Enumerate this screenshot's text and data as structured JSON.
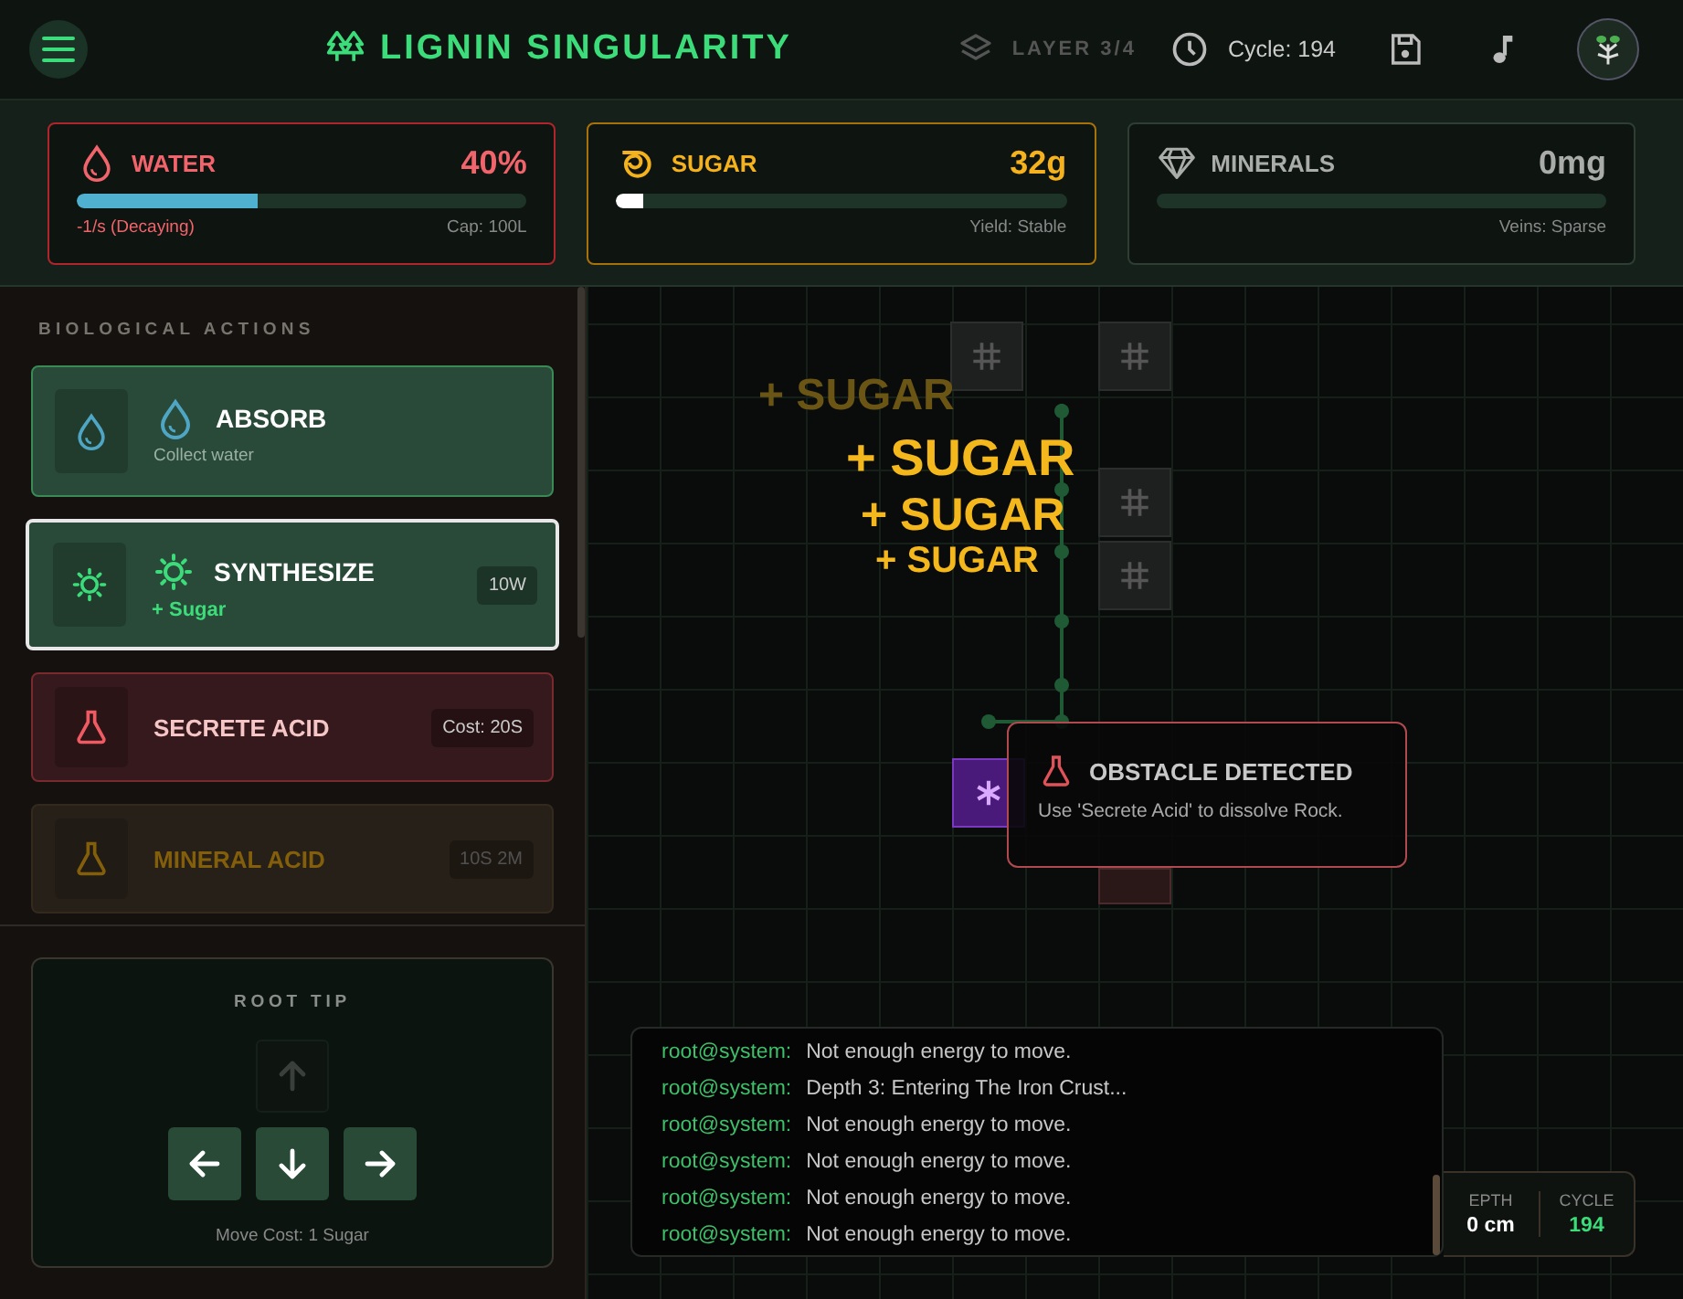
{
  "header": {
    "title": "LIGNIN SINGULARITY",
    "layer": "LAYER 3/4",
    "cycle": "Cycle: 194"
  },
  "resources": [
    {
      "kind": "water",
      "name": "WATER",
      "value": "40%",
      "level": 0.4,
      "note_left": "-1/s (Decaying)",
      "note_right": "Cap: 100L"
    },
    {
      "kind": "sugar",
      "name": "SUGAR",
      "value": "32g",
      "level": 0.06,
      "note_right": "Yield: Stable"
    },
    {
      "kind": "minerals",
      "name": "MINERALS",
      "value": "0mg",
      "note_right": "Veins: Sparse"
    }
  ],
  "sidebar": {
    "heading": "BIOLOGICAL ACTIONS",
    "actions": [
      {
        "kind": "water",
        "title": "ABSORB",
        "subtitle": "Collect water",
        "selected": false,
        "disabled": false
      },
      {
        "kind": "sun",
        "title": "SYNTHESIZE",
        "subtitle": "+ Sugar",
        "badge": "10W",
        "selected": true,
        "disabled": false
      },
      {
        "kind": "acid",
        "title": "SECRETE ACID",
        "badge": "Cost: 20S",
        "selected": false,
        "disabled": false
      },
      {
        "kind": "mineral",
        "title": "MINERAL ACID",
        "badge": "10S 2M",
        "selected": false,
        "disabled": true
      }
    ]
  },
  "root_tip": {
    "title": "ROOT TIP",
    "buttons": [
      {
        "kind": "up",
        "disabled": true
      },
      {
        "kind": "left",
        "disabled": false
      },
      {
        "kind": "down",
        "disabled": false
      },
      {
        "kind": "right",
        "disabled": false
      }
    ],
    "move_cost": "Move Cost: 1 Sugar"
  },
  "canvas": {
    "floaters": [
      {
        "text": "+ SUGAR",
        "faded": true
      },
      {
        "text": "+ SUGAR",
        "faded": false
      },
      {
        "text": "+ SUGAR",
        "faded": false
      },
      {
        "text": "+ SUGAR",
        "faded": false
      }
    ],
    "tooltip": {
      "title": "OBSTACLE DETECTED",
      "text": "Use 'Secrete Acid' to dissolve Rock."
    }
  },
  "log": [
    {
      "user": "root@system:",
      "message": "Not enough energy to move."
    },
    {
      "user": "root@system:",
      "message": "Depth 3: Entering The Iron Crust..."
    },
    {
      "user": "root@system:",
      "message": "Not enough energy to move."
    },
    {
      "user": "root@system:",
      "message": "Not enough energy to move."
    },
    {
      "user": "root@system:",
      "message": "Not enough energy to move."
    },
    {
      "user": "root@system:",
      "message": "Not enough energy to move."
    }
  ],
  "stats": [
    {
      "label": "EPTH",
      "value": "0 cm"
    },
    {
      "label": "CYCLE",
      "value": "194"
    }
  ]
}
